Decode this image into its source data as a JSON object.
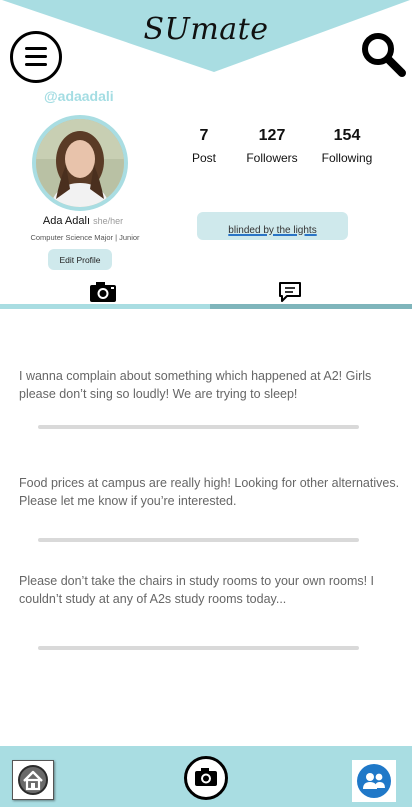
{
  "app": {
    "logo": "SUmate"
  },
  "profile": {
    "username": "@adaadali",
    "name": "Ada Adalı",
    "pronouns": "she/her",
    "major": "Computer Science Major | Junior",
    "edit_label": "Edit Profile",
    "song": "blinded by the lights"
  },
  "stats": [
    {
      "value": "7",
      "label": "Post"
    },
    {
      "value": "127",
      "label": "Followers"
    },
    {
      "value": "154",
      "label": "Following"
    }
  ],
  "tabs": [
    {
      "icon": "camera-icon",
      "active": true
    },
    {
      "icon": "chat-icon",
      "active": false
    }
  ],
  "posts": [
    {
      "text": "I wanna complain about something which happened at A2! Girls please don’t sing so loudly! We are trying to sleep!"
    },
    {
      "text": "Food prices at campus are really high! Looking for other alternatives. Please let me know if you’re interested."
    },
    {
      "text": "Please don’t take the chairs in study rooms to your own rooms! I couldn’t study at any of A2s study rooms today..."
    }
  ],
  "footer": {
    "items": [
      "home-icon",
      "camera-icon",
      "friends-icon"
    ]
  },
  "colors": {
    "accent": "#a9dde2",
    "accent_dark": "#7fb5bb",
    "link": "#2a74c6"
  }
}
